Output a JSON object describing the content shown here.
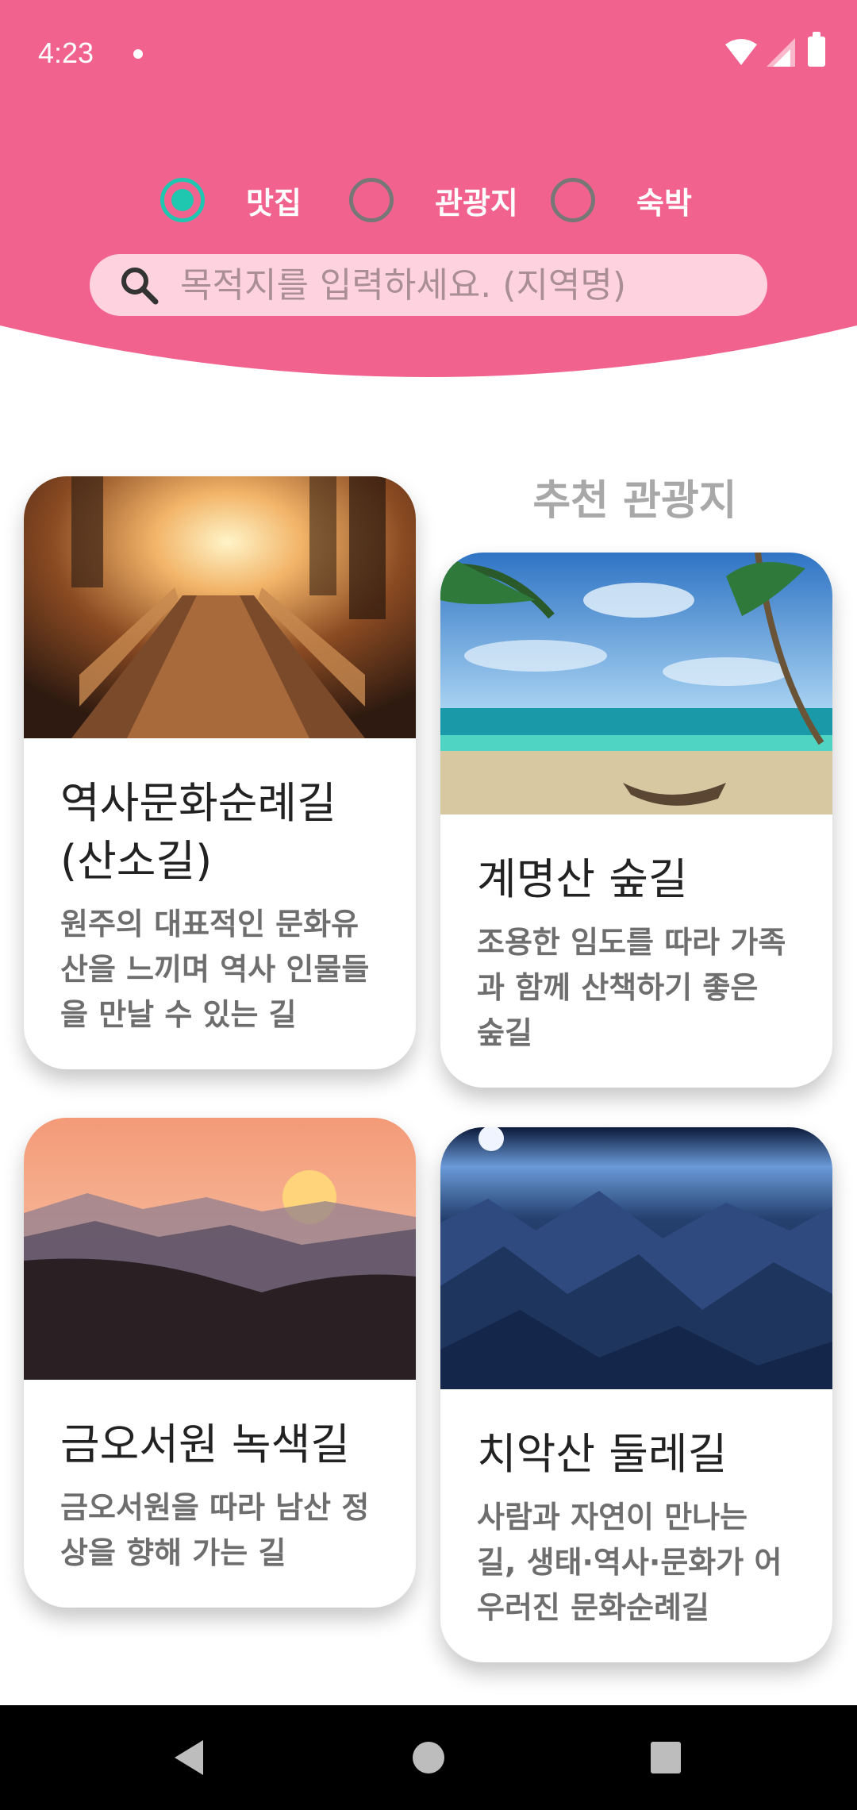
{
  "status_bar": {
    "time": "4:23"
  },
  "header": {
    "background_color": "#f2628f",
    "filters": [
      {
        "label": "맛집",
        "checked": true
      },
      {
        "label": "관광지",
        "checked": false
      },
      {
        "label": "숙박",
        "checked": false
      }
    ],
    "search": {
      "placeholder": "목적지를 입력하세요. (지역명)",
      "value": ""
    }
  },
  "section_title": "추천 관광지",
  "cards": [
    {
      "title": "역사문화순례길\n(산소길)",
      "description": "원주의 대표적인 문화유산을 느끼며 역사 인물들을 만날 수 있는 길",
      "image": "forest-bridge"
    },
    {
      "title": "계명산 숲길",
      "description": "조용한 임도를 따라 가족과 함께 산책하기 좋은 숲길",
      "image": "tropical-beach"
    },
    {
      "title": "금오서원 녹색길",
      "description": "금오서원을 따라 남산 정상을 향해 가는 길",
      "image": "sunset-mountains"
    },
    {
      "title": "치악산 둘레길",
      "description": "사람과 자연이 만나는 길, 생태·역사·문화가 어우러진 문화순례길",
      "image": "blue-mountains"
    }
  ],
  "nav": {
    "back": "back-icon",
    "home": "home-icon",
    "recents": "recents-icon"
  }
}
